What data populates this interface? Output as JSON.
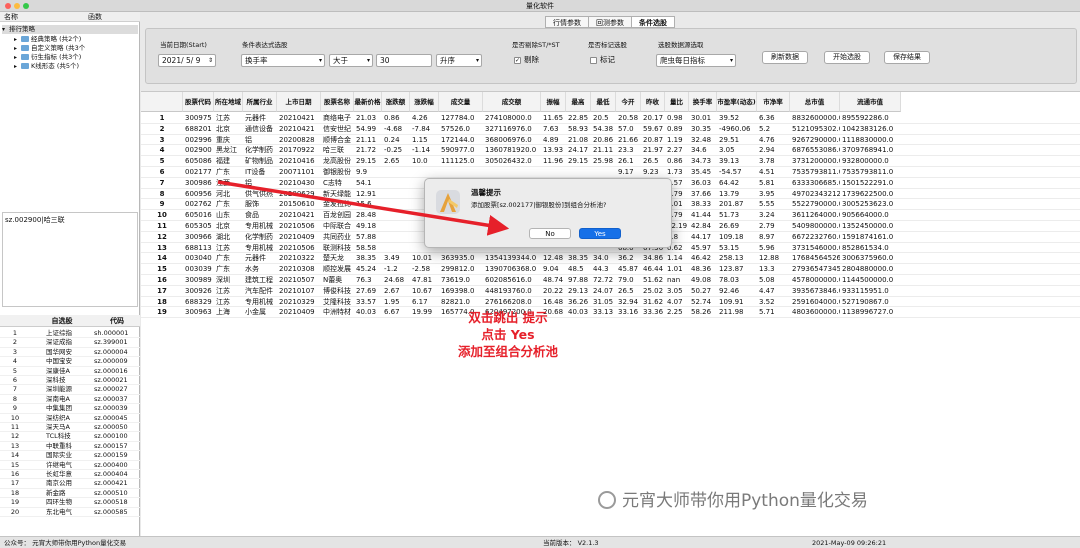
{
  "window": {
    "title": "量化软件"
  },
  "tree": {
    "col_name": "名称",
    "col_func": "函数",
    "root": "排行策略",
    "items": [
      "经典策略 (共2个)",
      "自定义策略 (共3个",
      "衍生指标 (共3个)",
      "K线形态 (共5个)"
    ]
  },
  "info_text": "sz.002900|哈三联",
  "stock_list": {
    "col_name": "自选股",
    "col_code": "代码",
    "rows": [
      [
        "1",
        "上证综指",
        "sh.000001"
      ],
      [
        "2",
        "深证成指",
        "sz.399001"
      ],
      [
        "3",
        "国华网安",
        "sz.000004"
      ],
      [
        "4",
        "中国宝安",
        "sz.000009"
      ],
      [
        "5",
        "深康佳A",
        "sz.000016"
      ],
      [
        "6",
        "深科技",
        "sz.000021"
      ],
      [
        "7",
        "深圳能源",
        "sz.000027"
      ],
      [
        "8",
        "深南电A",
        "sz.000037"
      ],
      [
        "9",
        "中集集团",
        "sz.000039"
      ],
      [
        "10",
        "深纺织A",
        "sz.000045"
      ],
      [
        "11",
        "深天马A",
        "sz.000050"
      ],
      [
        "12",
        "TCL科技",
        "sz.000100"
      ],
      [
        "13",
        "中联重科",
        "sz.000157"
      ],
      [
        "14",
        "国际实业",
        "sz.000159"
      ],
      [
        "15",
        "许继电气",
        "sz.000400"
      ],
      [
        "16",
        "长虹华意",
        "sz.000404"
      ],
      [
        "17",
        "南京公用",
        "sz.000421"
      ],
      [
        "18",
        "新金路",
        "sz.000510"
      ],
      [
        "19",
        "四环生物",
        "sz.000518"
      ],
      [
        "20",
        "东北电气",
        "sz.000585"
      ]
    ]
  },
  "tabs": [
    "行情参数",
    "回测参数",
    "条件选股"
  ],
  "active_tab": 2,
  "panel": {
    "date_label": "当前日期(Start)",
    "date_value": "2021/  5/  9",
    "expr_label": "条件表达式选股",
    "expr_field": "换手率",
    "expr_op": "大于",
    "expr_value": "30",
    "expr_sort": "升序",
    "st_label": "是否剔除ST/*ST",
    "st_option": "剔除",
    "st_checked": "✓",
    "mark_label": "是否标记选股",
    "mark_option": "标记",
    "source_label": "选股数据源选取",
    "source_value": "爬虫每日指标",
    "refresh_btn": "刷新数据",
    "start_btn": "开始选股",
    "save_btn": "保存结果"
  },
  "table": {
    "headers": [
      "",
      "股票代码",
      "所在地域",
      "所属行业",
      "上市日期",
      "股票名称",
      "最新价格",
      "涨跌额",
      "涨跌幅",
      "成交量",
      "成交额",
      "振幅",
      "最高",
      "最低",
      "今开",
      "昨收",
      "量比",
      "换手率",
      "市盈率(动态)",
      "市净率",
      "总市值",
      "流通市值"
    ],
    "rows": [
      [
        "1",
        "300975",
        "江苏",
        "元器件",
        "20210421",
        "商络电子",
        "21.03",
        "0.86",
        "4.26",
        "127784.0",
        "274108000.0",
        "11.65",
        "22.85",
        "20.5",
        "20.58",
        "20.17",
        "0.98",
        "30.01",
        "39.52",
        "6.36",
        "8832600000.0",
        "895592286.0"
      ],
      [
        "2",
        "688201",
        "北京",
        "通信设备",
        "20210421",
        "信安世纪",
        "54.99",
        "-4.68",
        "-7.84",
        "57526.0",
        "327116976.0",
        "7.63",
        "58.93",
        "54.38",
        "57.0",
        "59.67",
        "0.89",
        "30.35",
        "-4960.06",
        "5.2",
        "5121095302.0",
        "1042383126.0"
      ],
      [
        "3",
        "002996",
        "重庆",
        "铝",
        "20200828",
        "顺博合金",
        "21.11",
        "0.24",
        "1.15",
        "172144.0",
        "368006976.0",
        "4.89",
        "21.08",
        "20.86",
        "21.66",
        "20.87",
        "1.19",
        "32.48",
        "29.51",
        "4.76",
        "9267290000.0",
        "1118830000.0"
      ],
      [
        "4",
        "002900",
        "黑龙江",
        "化学制药",
        "20170922",
        "哈三联",
        "21.72",
        "-0.25",
        "-1.14",
        "590977.0",
        "1360781920.0",
        "13.93",
        "24.17",
        "21.11",
        "23.3",
        "21.97",
        "2.27",
        "34.6",
        "3.05",
        "2.94",
        "6876553086.0",
        "3709768941.0"
      ],
      [
        "5",
        "605086",
        "福建",
        "矿物制品",
        "20210416",
        "龙高股份",
        "29.15",
        "2.65",
        "10.0",
        "111125.0",
        "305026432.0",
        "11.96",
        "29.15",
        "25.98",
        "26.1",
        "26.5",
        "0.86",
        "34.73",
        "39.13",
        "3.78",
        "3731200000.0",
        "932800000.0"
      ],
      [
        "6",
        "002177",
        "广东",
        "IT设备",
        "20071101",
        "御银股份",
        "9.9",
        "",
        "",
        "",
        "",
        "",
        "",
        "",
        "9.17",
        "9.23",
        "1.73",
        "35.45",
        "-54.57",
        "4.51",
        "7535793811.0",
        "7535793811.0"
      ],
      [
        "7",
        "300986",
        "江西",
        "铝",
        "20210430",
        "C志特",
        "54.1",
        "",
        "",
        "",
        "",
        "",
        "",
        "",
        "53.0",
        "55.9",
        "0.57",
        "36.03",
        "64.42",
        "5.81",
        "6333306685.0",
        "1501522291.0"
      ],
      [
        "8",
        "600956",
        "河北",
        "供气供热",
        "20200629",
        "新天绿能",
        "12.91",
        "",
        "",
        "",
        "",
        "",
        "",
        "",
        "13.24",
        "12.85",
        "1.79",
        "37.66",
        "13.79",
        "3.95",
        "49702343212.0",
        "1739622500.0"
      ],
      [
        "9",
        "002762",
        "广东",
        "服饰",
        "20150610",
        "金发拉比",
        "15.6",
        "",
        "",
        "",
        "",
        "",
        "",
        "",
        "17.44",
        "16.83",
        "1.01",
        "38.33",
        "201.87",
        "5.55",
        "5522790000.0",
        "3005253623.0"
      ],
      [
        "10",
        "605016",
        "山东",
        "食品",
        "20210421",
        "百龙创园",
        "28.48",
        "",
        "",
        "",
        "",
        "",
        "",
        "",
        "26.58",
        "26.35",
        "1.79",
        "41.44",
        "51.73",
        "3.24",
        "3611264000.0",
        "905664000.0"
      ],
      [
        "11",
        "605305",
        "北京",
        "专用机械",
        "20210506",
        "中际联合",
        "49.18",
        "",
        "",
        "",
        "",
        "",
        "",
        "",
        "55.0",
        "54.63",
        "12.19",
        "42.84",
        "26.69",
        "2.79",
        "5409800000.0",
        "1352450000.0"
      ],
      [
        "12",
        "300966",
        "湖北",
        "化学制药",
        "20210409",
        "共同药业",
        "57.88",
        "",
        "",
        "",
        "",
        "",
        "",
        "",
        "67.64",
        "70.15",
        "0.8",
        "44.17",
        "109.18",
        "8.97",
        "6672232760.0",
        "1591874161.0"
      ],
      [
        "13",
        "688113",
        "江苏",
        "专用机械",
        "20210506",
        "联测科技",
        "58.58",
        "",
        "",
        "",
        "",
        "",
        "",
        "",
        "68.0",
        "67.36",
        "0.62",
        "45.97",
        "53.15",
        "5.96",
        "3731546000.0",
        "852861534.0"
      ],
      [
        "14",
        "003040",
        "广东",
        "元器件",
        "20210322",
        "楚天龙",
        "38.35",
        "3.49",
        "10.01",
        "363935.0",
        "1354139344.0",
        "12.48",
        "38.35",
        "34.0",
        "36.2",
        "34.86",
        "1.14",
        "46.42",
        "258.13",
        "12.88",
        "17684564526.0",
        "3006375960.0"
      ],
      [
        "15",
        "003039",
        "广东",
        "水务",
        "20210308",
        "顺控发展",
        "45.24",
        "-1.2",
        "-2.58",
        "299812.0",
        "1390706368.0",
        "9.04",
        "48.5",
        "44.3",
        "45.87",
        "46.44",
        "1.01",
        "48.36",
        "123.87",
        "13.3",
        "27936547345.0",
        "2804880000.0"
      ],
      [
        "16",
        "300989",
        "深圳",
        "建筑工程",
        "20210507",
        "N蕾奥",
        "76.3",
        "24.68",
        "47.81",
        "73619.0",
        "602085616.0",
        "48.74",
        "97.88",
        "72.72",
        "79.0",
        "51.62",
        "nan",
        "49.08",
        "78.03",
        "5.08",
        "4578000000.0",
        "1144500000.0"
      ],
      [
        "17",
        "300926",
        "江苏",
        "汽车配件",
        "20210107",
        "博俊科技",
        "27.69",
        "2.67",
        "10.67",
        "169398.0",
        "448193760.0",
        "20.22",
        "29.13",
        "24.07",
        "26.5",
        "25.02",
        "3.05",
        "50.27",
        "92.46",
        "4.47",
        "3935673846.0",
        "933115951.0"
      ],
      [
        "18",
        "688329",
        "江苏",
        "专用机械",
        "20210329",
        "艾隆科技",
        "33.57",
        "1.95",
        "6.17",
        "82821.0",
        "276166208.0",
        "16.48",
        "36.26",
        "31.05",
        "32.94",
        "31.62",
        "4.07",
        "52.74",
        "109.91",
        "3.52",
        "2591604000.0",
        "527190867.0"
      ],
      [
        "19",
        "300963",
        "上海",
        "小金属",
        "20210409",
        "中洲特材",
        "40.03",
        "6.67",
        "19.99",
        "165774.0",
        "620497200.0",
        "20.68",
        "40.03",
        "33.13",
        "33.16",
        "33.36",
        "2.25",
        "58.26",
        "211.98",
        "5.71",
        "4803600000.0",
        "1138996727.0"
      ]
    ]
  },
  "dialog": {
    "title": "温馨提示",
    "message": "添加股票[sz.002177|御银股份]到组合分析池?",
    "no": "No",
    "yes": "Yes"
  },
  "annotation": [
    "双击跳出 提示",
    "点击 Yes",
    "添加至组合分析池"
  ],
  "watermark": "元宵大师带你用Python量化交易",
  "status": {
    "left": "公众号： 元宵大师带你用Python量化交易",
    "version": "当前版本： V2.1.3",
    "time": "2021-May-09 09:26:21"
  },
  "colors": {
    "accent": "#1670e8",
    "annotation": "#e6202a",
    "arrow": "#e6202a"
  }
}
